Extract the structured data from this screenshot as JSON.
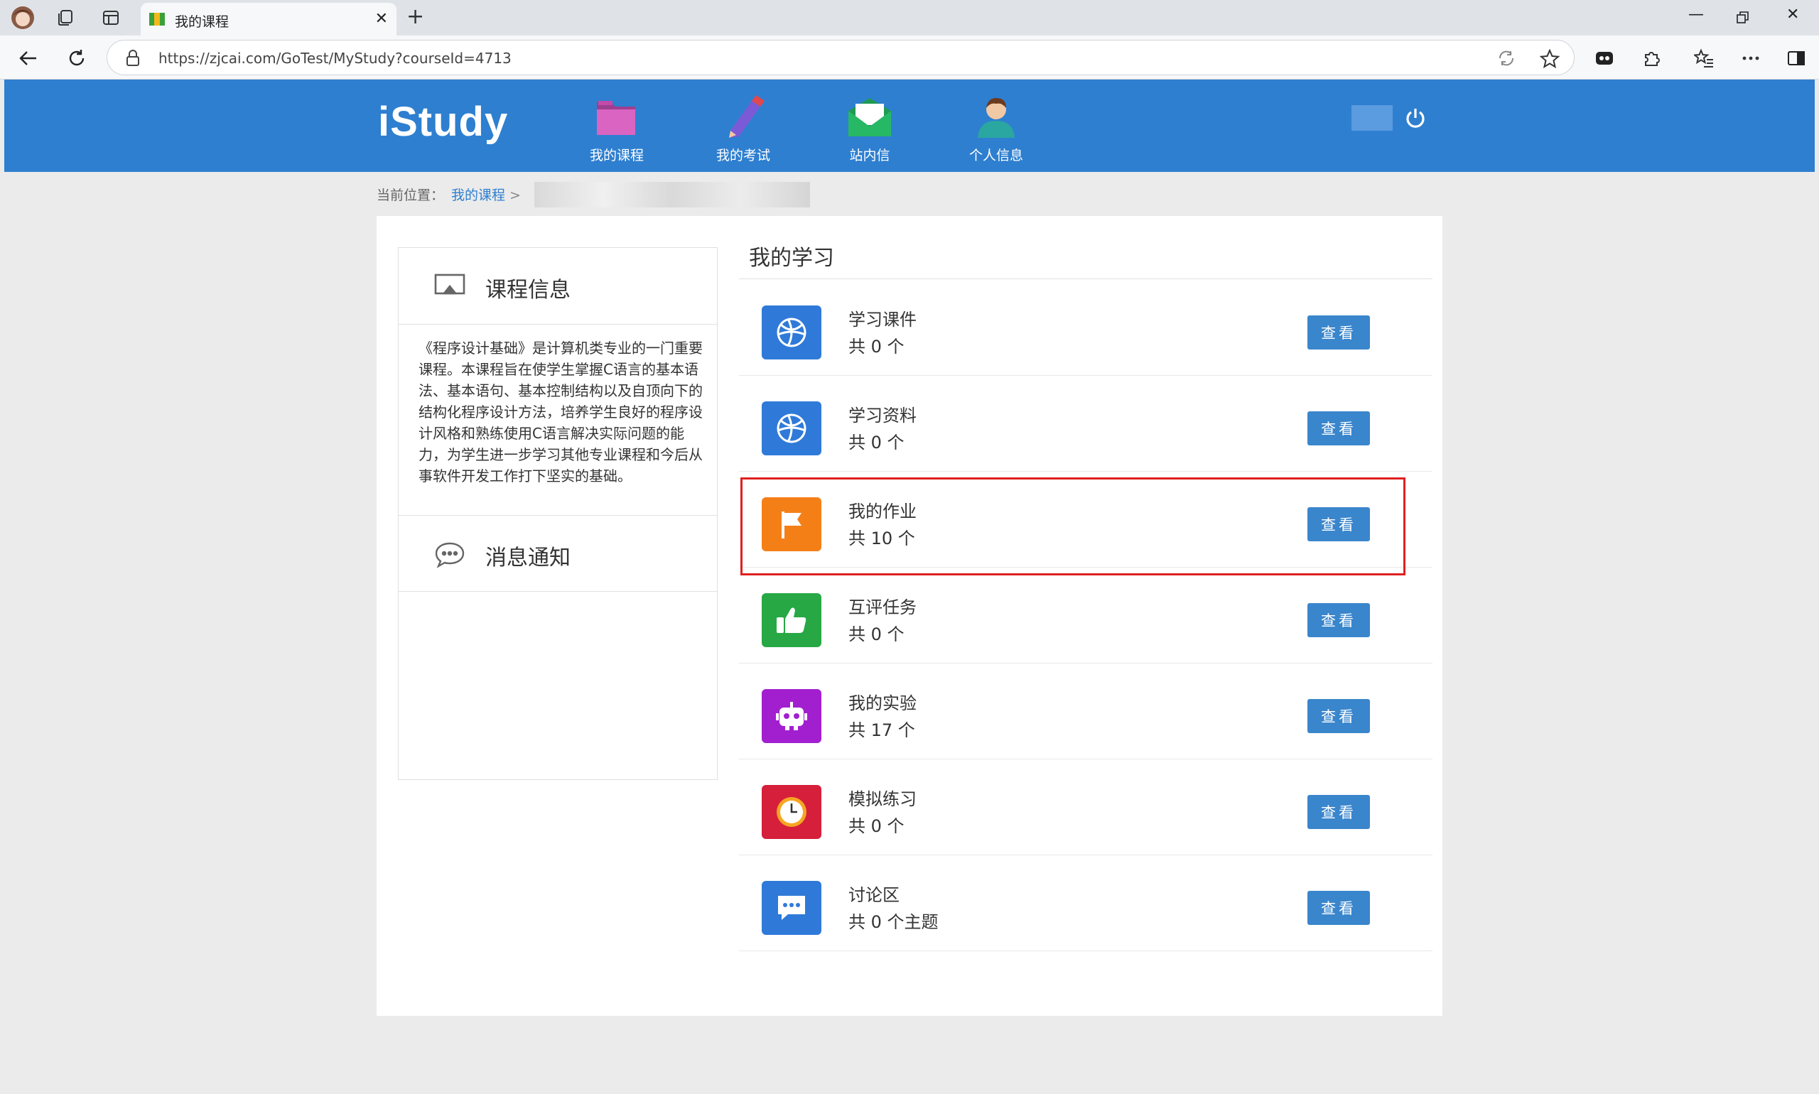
{
  "browser": {
    "tab_title": "我的课程",
    "url": "https://zjcai.com/GoTest/MyStudy?courseId=4713"
  },
  "site": {
    "logo": "iStudy",
    "nav": [
      {
        "label": "我的课程"
      },
      {
        "label": "我的考试"
      },
      {
        "label": "站内信"
      },
      {
        "label": "个人信息"
      }
    ]
  },
  "breadcrumb": {
    "prefix": "当前位置：",
    "link": "我的课程",
    "separator": ">"
  },
  "sidebar": {
    "course_info_title": "课程信息",
    "course_desc": "《程序设计基础》是计算机类专业的一门重要课程。本课程旨在使学生掌握C语言的基本语法、基本语句、基本控制结构以及自顶向下的结构化程序设计方法，培养学生良好的程序设计风格和熟练使用C语言解决实际问题的能力，为学生进一步学习其他专业课程和今后从事软件开发工作打下坚实的基础。",
    "notice_title": "消息通知"
  },
  "study": {
    "title": "我的学习",
    "button_label": "查看",
    "items": [
      {
        "name": "学习课件",
        "count": "共 0 个",
        "icon": "basketball-icon",
        "color": "#2f7ad8"
      },
      {
        "name": "学习资料",
        "count": "共 0 个",
        "icon": "basketball-icon",
        "color": "#2f7ad8"
      },
      {
        "name": "我的作业",
        "count": "共 10 个",
        "icon": "flag-icon",
        "color": "#f57f17"
      },
      {
        "name": "互评任务",
        "count": "共 0 个",
        "icon": "thumbs-up-icon",
        "color": "#27a845"
      },
      {
        "name": "我的实验",
        "count": "共 17 个",
        "icon": "robot-icon",
        "color": "#a21fd0"
      },
      {
        "name": "模拟练习",
        "count": "共 0 个",
        "icon": "clock-icon",
        "color": "#d61f3a"
      },
      {
        "name": "讨论区",
        "count": "共 0 个主题",
        "icon": "chat-bubble-icon",
        "color": "#2f7ad8"
      }
    ]
  }
}
